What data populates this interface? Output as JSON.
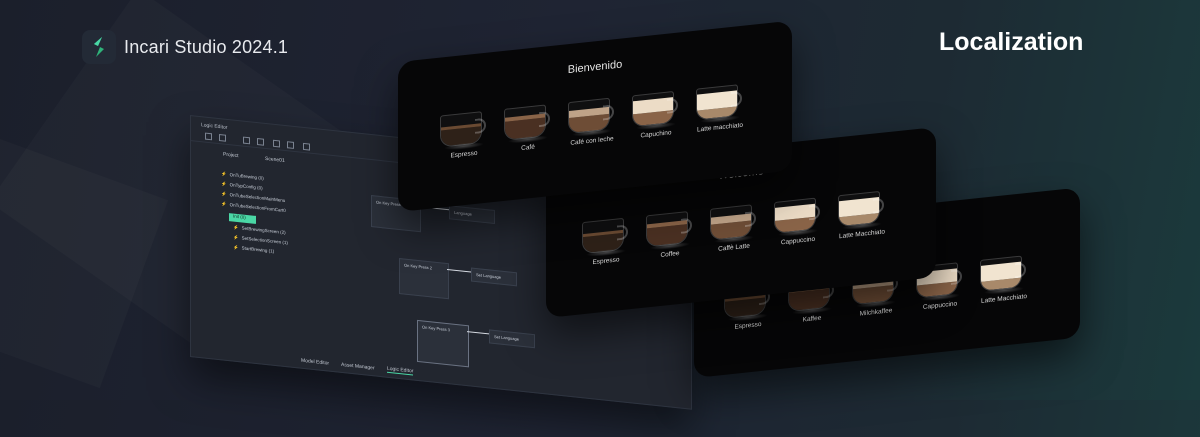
{
  "brand": {
    "name": "Incari Studio 2024.1"
  },
  "page_title": "Localization",
  "editor": {
    "window_title": "Logic Editor",
    "tabs": [
      "Project",
      "Scene01"
    ],
    "tree_items": [
      {
        "label": "OnTuBrewing (0)",
        "selected": false
      },
      {
        "label": "OnTypConfig (0)",
        "selected": false
      },
      {
        "label": "OnTubeSelectionMainMenu",
        "selected": false
      },
      {
        "label": "OnTubeSelectionFromCart0",
        "selected": false
      },
      {
        "label": "Init (0)",
        "selected": true
      },
      {
        "label": "SetBrewingScreen (2)",
        "selected": false
      },
      {
        "label": "SetSelectionScreen (1)",
        "selected": false
      },
      {
        "label": "StartBrewing (1)",
        "selected": false
      }
    ],
    "nodes": [
      {
        "title": "On Key Press 1",
        "pins": [
          "Language"
        ]
      },
      {
        "title": "On Key Press 2",
        "pins": [
          "Set Language"
        ]
      },
      {
        "title": "On Key Press 3",
        "pins": [
          "Set Language"
        ]
      }
    ],
    "bottom_tabs": [
      "Model Editor",
      "Asset Manager",
      "Logic Editor"
    ]
  },
  "panels": [
    {
      "heading": "Bienvenido",
      "drinks": [
        "Espresso",
        "Café",
        "Café con leche",
        "Capuchino",
        "Latte macchiato"
      ]
    },
    {
      "heading": "Welcome",
      "drinks": [
        "Espresso",
        "Coffee",
        "Caffè Latte",
        "Cappuccino",
        "Latte Macchiato"
      ]
    },
    {
      "heading": "",
      "drinks": [
        "Espresso",
        "Kaffee",
        "Milchkaffee",
        "Cappuccino",
        "Latte Macchiato"
      ]
    }
  ],
  "colors": {
    "accent": "#4ad7a5",
    "background": "#1f2433",
    "panel": "#060607",
    "warning": "#f5c242"
  },
  "icons": [
    "incari-logo-icon",
    "bolt-icon"
  ]
}
